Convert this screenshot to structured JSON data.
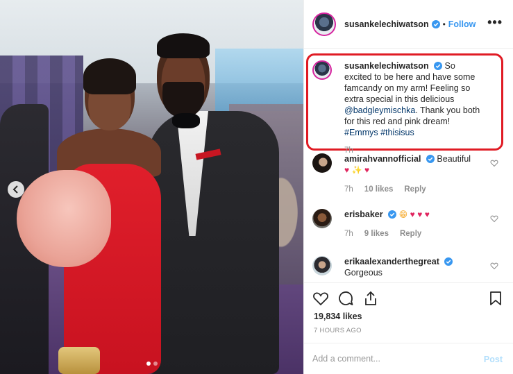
{
  "post": {
    "author": "susankelechiwatson",
    "follow_label": "Follow",
    "header_separator": "•",
    "more_label": "•••"
  },
  "photo": {
    "carousel_count": 2,
    "carousel_active": 1
  },
  "caption": {
    "user": "susankelechiwatson",
    "text_parts": [
      "So excited to be here and have some famcandy on my arm! Feeling so extra special in this delicious ",
      "@badgleymischka",
      ". Thank you both for this red and pink dream! ",
      "#Emmys",
      " ",
      "#thisisus"
    ],
    "time": "7h"
  },
  "comments": [
    {
      "user": "amirahvannofficial",
      "verified": true,
      "text": "Beautiful",
      "emoji": [
        "♥",
        "✨",
        "♥"
      ],
      "time": "7h",
      "likes": "10 likes",
      "reply": "Reply"
    },
    {
      "user": "erisbaker",
      "verified": true,
      "text": "",
      "emoji": [
        "😁",
        "♥",
        "♥",
        "♥"
      ],
      "time": "7h",
      "likes": "9 likes",
      "reply": "Reply"
    },
    {
      "user": "erikaalexanderthegreat",
      "verified": true,
      "text": "Gorgeous"
    }
  ],
  "stats": {
    "likes": "19,834 likes",
    "time_ago": "7 HOURS AGO"
  },
  "composer": {
    "placeholder": "Add a comment...",
    "post_label": "Post"
  },
  "colors": {
    "link_blue": "#3897f0",
    "verified_blue": "#3897f0",
    "highlight_red": "#e01b24",
    "heart_red": "#ed4956"
  }
}
